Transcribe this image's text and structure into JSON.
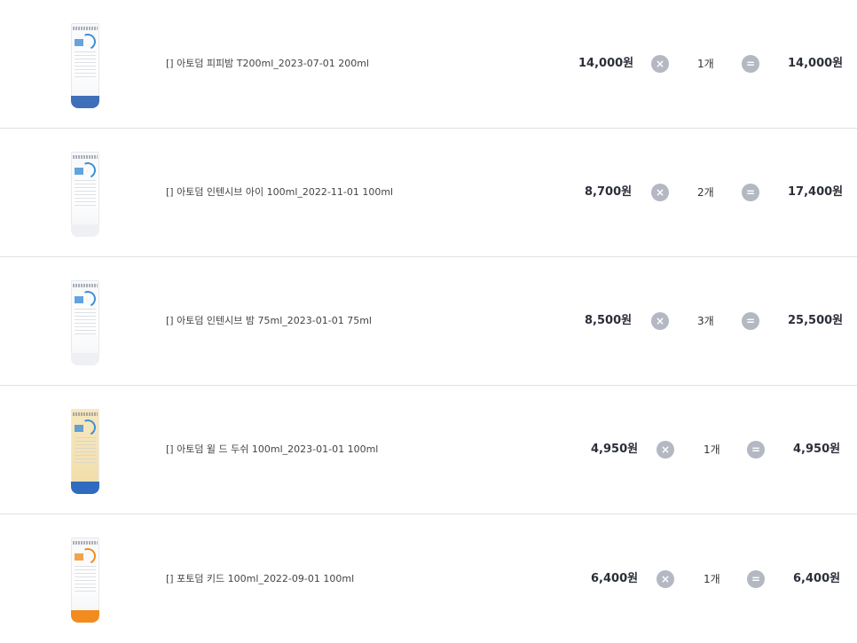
{
  "items": [
    {
      "name": "[] 아토덤 피피밤 T200ml_2023-07-01 200ml",
      "price": "14,000원",
      "times": "×",
      "qty": "1개",
      "equals": "=",
      "total": "14,000원",
      "cap_color": "#3f6fb8",
      "accent_color": "#3d8fd6"
    },
    {
      "name": "[] 아토덤 인텐시브 아이 100ml_2022-11-01 100ml",
      "price": "8,700원",
      "times": "×",
      "qty": "2개",
      "equals": "=",
      "total": "17,400원",
      "cap_color": "#f4f5f7",
      "accent_color": "#3d8fd6"
    },
    {
      "name": "[] 아토덤 인텐시브 밤 75ml_2023-01-01 75ml",
      "price": "8,500원",
      "times": "×",
      "qty": "3개",
      "equals": "=",
      "total": "25,500원",
      "cap_color": "#f4f5f7",
      "accent_color": "#3d8fd6"
    },
    {
      "name": "[] 아토덤 윌 드 두쉬 100ml_2023-01-01 100ml",
      "price": "4,950원",
      "times": "×",
      "qty": "1개",
      "equals": "=",
      "total": "4,950원",
      "cap_color": "#2f6cc0",
      "accent_color": "#3d8fd6",
      "body_tint": "#f3e2b3"
    },
    {
      "name": "[] 포토덤 키드 100ml_2022-09-01 100ml",
      "price": "6,400원",
      "times": "×",
      "qty": "1개",
      "equals": "=",
      "total": "6,400원",
      "cap_color": "#f28c1e",
      "accent_color": "#f28c1e"
    }
  ]
}
